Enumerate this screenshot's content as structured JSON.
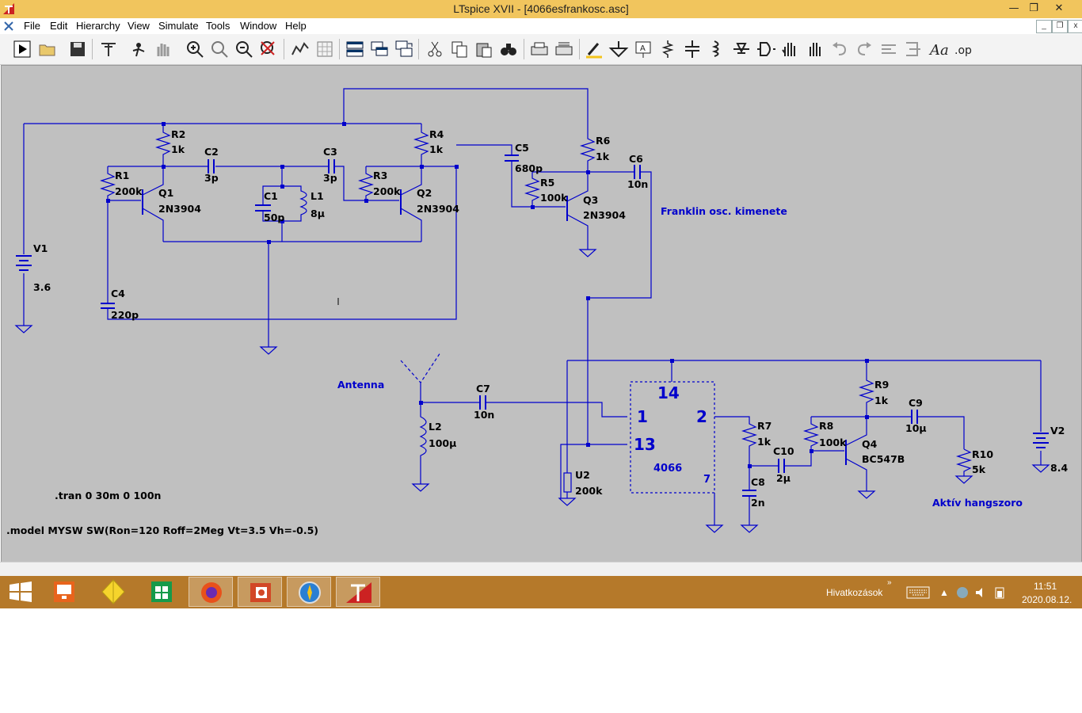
{
  "window": {
    "title": "LTspice XVII - [4066esfrankosc.asc]"
  },
  "menu": [
    "File",
    "Edit",
    "Hierarchy",
    "View",
    "Simulate",
    "Tools",
    "Window",
    "Help"
  ],
  "toolbar_icons": [
    "run-icon",
    "open-icon",
    "save-icon",
    "control-panel-icon",
    "halt-icon",
    "hand-icon",
    "zoom-in-icon",
    "zoom-pan-icon",
    "zoom-out-icon",
    "zoom-fit-icon",
    "autorange-icon",
    "grid-icon",
    "tile-horizontal-icon",
    "tile-vertical-icon",
    "cascade-icon",
    "cut-icon",
    "copy-icon",
    "paste-icon",
    "find-icon",
    "print-icon",
    "print-setup-icon",
    "draw-wire-icon",
    "ground-icon",
    "label-net-icon",
    "resistor-icon",
    "capacitor-icon",
    "inductor-icon",
    "diode-icon",
    "component-icon",
    "move-icon",
    "drag-icon",
    "undo-icon",
    "redo-icon",
    "rotate-icon",
    "mirror-icon",
    "text-icon",
    "spice-directive-icon"
  ],
  "schematic": {
    "components": {
      "R1": {
        "name": "R1",
        "value": "200k"
      },
      "R2": {
        "name": "R2",
        "value": "1k"
      },
      "R3": {
        "name": "R3",
        "value": "200k"
      },
      "R4": {
        "name": "R4",
        "value": "1k"
      },
      "R5": {
        "name": "R5",
        "value": "100k"
      },
      "R6": {
        "name": "R6",
        "value": "1k"
      },
      "R7": {
        "name": "R7",
        "value": "1k"
      },
      "R8": {
        "name": "R8",
        "value": "100k"
      },
      "R9": {
        "name": "R9",
        "value": "1k"
      },
      "R10": {
        "name": "R10",
        "value": "5k"
      },
      "C1": {
        "name": "C1",
        "value": "50p"
      },
      "C2": {
        "name": "C2",
        "value": "3p"
      },
      "C3": {
        "name": "C3",
        "value": "3p"
      },
      "C4": {
        "name": "C4",
        "value": "220p"
      },
      "C5": {
        "name": "C5",
        "value": "680p"
      },
      "C6": {
        "name": "C6",
        "value": "10n"
      },
      "C7": {
        "name": "C7",
        "value": "10n"
      },
      "C8": {
        "name": "C8",
        "value": "2n"
      },
      "C9": {
        "name": "C9",
        "value": "10µ"
      },
      "C10": {
        "name": "C10",
        "value": "2µ"
      },
      "L1": {
        "name": "L1",
        "value": "8µ"
      },
      "L2": {
        "name": "L2",
        "value": "100µ"
      },
      "Q1": {
        "name": "Q1",
        "value": "2N3904"
      },
      "Q2": {
        "name": "Q2",
        "value": "2N3904"
      },
      "Q3": {
        "name": "Q3",
        "value": "2N3904"
      },
      "Q4": {
        "name": "Q4",
        "value": "BC547B"
      },
      "V1": {
        "name": "V1",
        "value": "3.6"
      },
      "V2": {
        "name": "V2",
        "value": "8.4"
      },
      "U2": {
        "name": "U2",
        "value": "200k"
      }
    },
    "ic": {
      "part": "4066",
      "pin_vdd": "14",
      "pin_in": "1",
      "pin_out": "2",
      "pin_ctrl": "13",
      "pin_gnd": "7"
    },
    "labels": {
      "franklin": "Franklin osc. kimenete",
      "antenna": "Antenna",
      "speaker": "Aktív hangszoro"
    },
    "directives": {
      "tran": ".tran 0 30m 0 100n",
      "model": ".model MYSW SW(Ron=120 Roff=2Meg Vt=3.5 Vh=-0.5)"
    },
    "wire_color": "#0000cc",
    "label_color": "#0000cc",
    "canvas_color": "#c0c0c0"
  },
  "taskbar": {
    "apps": [
      "start-icon",
      "remote-desktop-icon",
      "app-yellow-icon",
      "store-icon",
      "firefox-icon",
      "office-icon",
      "browser-icon",
      "ltspice-icon"
    ],
    "tray_label": "Hivatkozások",
    "time": "11:51",
    "date": "2020.08.12."
  }
}
